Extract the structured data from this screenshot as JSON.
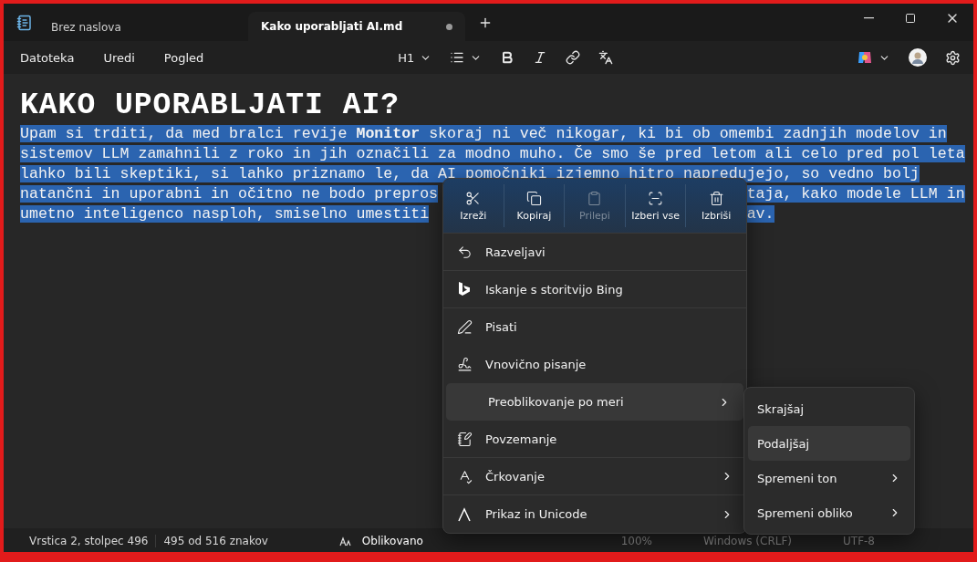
{
  "tabs": [
    {
      "label": "Brez naslova",
      "selected": false,
      "unsaved": false
    },
    {
      "label": "Kako uporabljati AI.md",
      "selected": true,
      "unsaved": true
    }
  ],
  "menu_bar": [
    "Datoteka",
    "Uredi",
    "Pogled"
  ],
  "format_toolbar": {
    "heading": "H1"
  },
  "document": {
    "title": "KAKO UPORABLJATI AI?",
    "lines": [
      {
        "text": "Upam si trditi, da med bralci revije **Monitor** skoraj ni več nikogar, ki bi ob omembi zadnjih modelov in"
      },
      {
        "text": "sistemov LLM zamahnili z roko in jih označili za modno muho. Če smo še pred letom ali celo pred pol leta"
      },
      {
        "text": "lahko bili skeptiki, si lahko priznamo le, da AI pomočniki izjemno hitro napredujejo, so vedno bolj"
      },
      {
        "text": "natančni in uporabni in očitno ne bodo prepros",
        "text_right": "taja, kako modele LLM in"
      },
      {
        "text": "umetno inteligenco nasploh, smiselno umestiti",
        "text_right": "av."
      }
    ]
  },
  "context_menu": {
    "actions": [
      {
        "label": "Izreži",
        "kind": "cut",
        "disabled": false
      },
      {
        "label": "Kopiraj",
        "kind": "copy",
        "disabled": false
      },
      {
        "label": "Prilepi",
        "kind": "paste",
        "disabled": true
      },
      {
        "label": "Izberi vse",
        "kind": "select-all",
        "disabled": false
      },
      {
        "label": "Izbriši",
        "kind": "delete",
        "disabled": false
      }
    ],
    "items": [
      {
        "label": "Razveljavi",
        "kind": "undo",
        "submenu": false,
        "selected": false
      },
      {
        "label": "Iskanje s storitvijo Bing",
        "kind": "bing",
        "submenu": false,
        "selected": false
      },
      {
        "label": "Pisati",
        "kind": "write",
        "submenu": false,
        "selected": false
      },
      {
        "label": "Vnovično pisanje",
        "kind": "rewrite",
        "submenu": false,
        "selected": false
      },
      {
        "label": "Preoblikovanje po meri",
        "kind": "none",
        "submenu": true,
        "selected": true
      },
      {
        "label": "Povzemanje",
        "kind": "summarize",
        "submenu": false,
        "selected": false
      },
      {
        "label": "Črkovanje",
        "kind": "spelling",
        "submenu": true,
        "selected": false
      },
      {
        "label": "Prikaz in Unicode",
        "kind": "unicode",
        "submenu": true,
        "selected": false
      }
    ]
  },
  "submenu": {
    "items": [
      {
        "label": "Skrajšaj",
        "submenu": false,
        "selected": false
      },
      {
        "label": "Podaljšaj",
        "submenu": false,
        "selected": true
      },
      {
        "label": "Spremeni ton",
        "submenu": true,
        "selected": false
      },
      {
        "label": "Spremeni obliko",
        "submenu": true,
        "selected": false
      }
    ]
  },
  "status_bar": {
    "position": "Vrstica 2, stolpec 496",
    "count": "495 od 516 znakov",
    "format": "Oblikovano",
    "zoom": "100%",
    "line_ending": "Windows (CRLF)",
    "encoding": "UTF-8"
  }
}
